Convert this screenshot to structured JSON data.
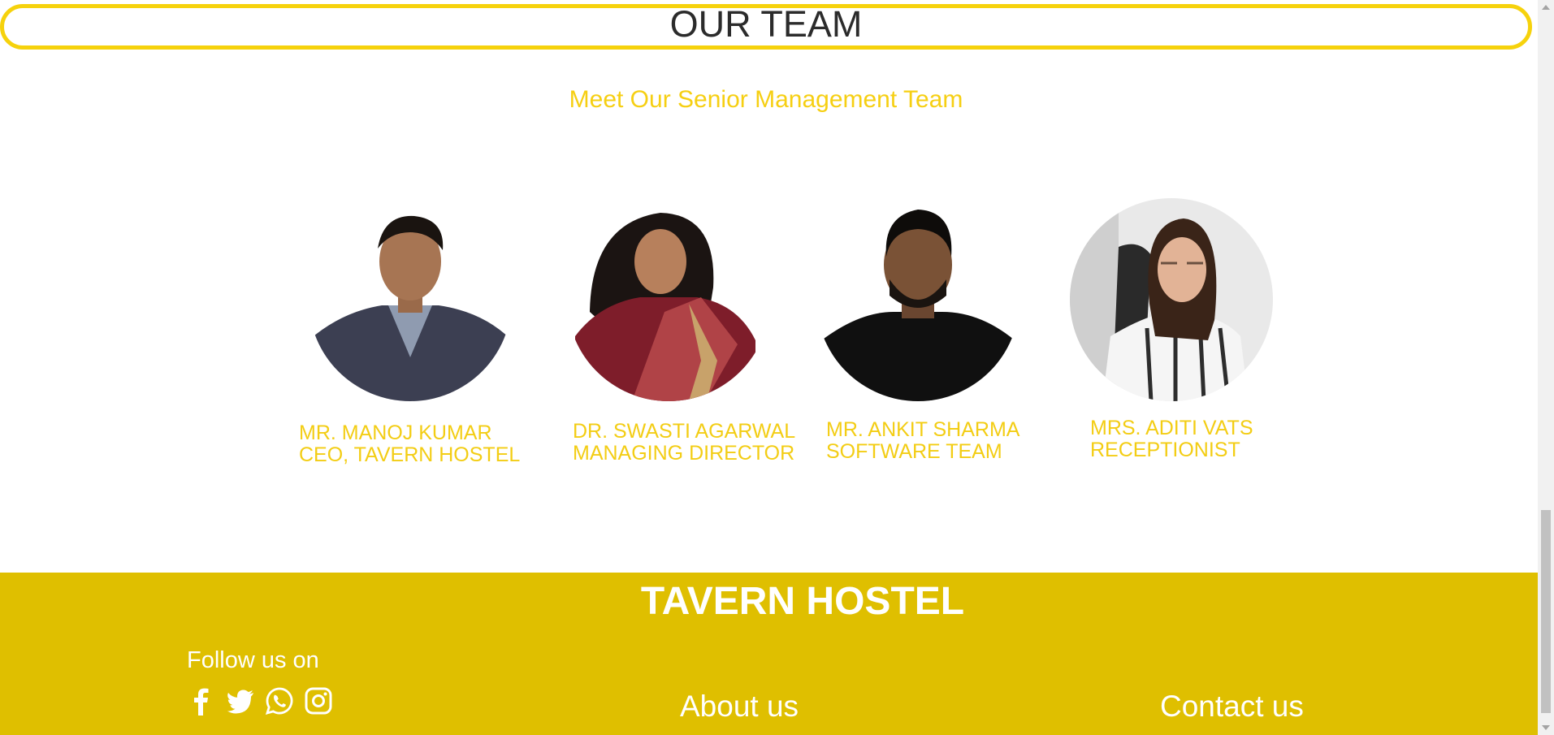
{
  "team": {
    "heading": "OUR TEAM",
    "subtitle": "Meet Our Senior Management Team",
    "members": [
      {
        "name": "MR. MANOJ KUMAR",
        "role": "CEO, TAVERN HOSTEL"
      },
      {
        "name": "DR. SWASTI AGARWAL",
        "role": "MANAGING DIRECTOR"
      },
      {
        "name": "MR. ANKIT SHARMA",
        "role": "SOFTWARE TEAM"
      },
      {
        "name": "MRS. ADITI VATS",
        "role": "RECEPTIONIST"
      }
    ]
  },
  "footer": {
    "brand": "TAVERN HOSTEL",
    "follow": "Follow us on",
    "social_icons": [
      "facebook-icon",
      "twitter-icon",
      "whatsapp-icon",
      "instagram-icon"
    ],
    "about": "About us",
    "contact": "Contact us"
  },
  "colors": {
    "accent": "#f6d20c",
    "caption": "#f3cd14",
    "footer_bg": "#dfbf00"
  }
}
